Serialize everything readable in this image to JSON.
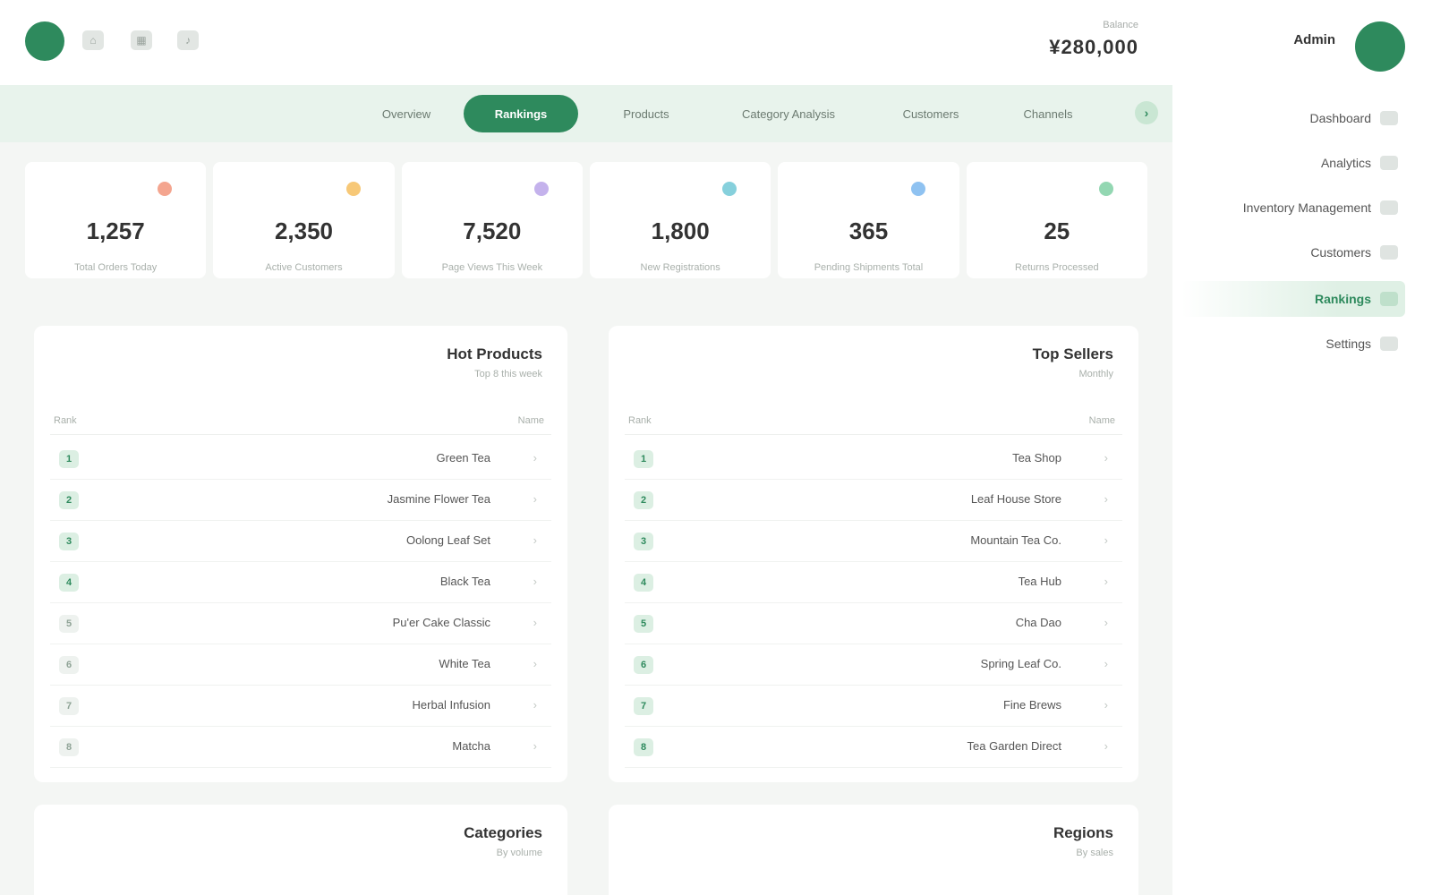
{
  "header": {
    "icons": [
      "home-icon",
      "grid-icon",
      "bell-icon"
    ],
    "subtitle": "Balance",
    "amount": "¥280,000"
  },
  "tabs": [
    {
      "label": "Overview"
    },
    {
      "label": "Rankings"
    },
    {
      "label": "Products"
    },
    {
      "label": "Category Analysis"
    },
    {
      "label": "Customers"
    },
    {
      "label": "Channels"
    }
  ],
  "stats": [
    {
      "value": "1,257",
      "label": "Total Orders Today",
      "color": "#f4a58f"
    },
    {
      "value": "2,350",
      "label": "Active Customers",
      "color": "#f7c877"
    },
    {
      "value": "7,520",
      "label": "Page Views This Week",
      "color": "#c4b2ec"
    },
    {
      "value": "1,800",
      "label": "New Registrations",
      "color": "#86d0dc"
    },
    {
      "value": "365",
      "label": "Pending Shipments Total",
      "color": "#8fc2f1"
    },
    {
      "value": "25",
      "label": "Returns Processed",
      "color": "#93d7b2"
    }
  ],
  "panels": [
    {
      "title": "Hot Products",
      "subtitle": "Top 8 this week",
      "col_rank": "Rank",
      "col_right": "Name",
      "rows": [
        {
          "rank": "1",
          "name": "Green Tea"
        },
        {
          "rank": "2",
          "name": "Jasmine Flower Tea"
        },
        {
          "rank": "3",
          "name": "Oolong Leaf Set"
        },
        {
          "rank": "4",
          "name": "Black Tea"
        },
        {
          "rank": "5",
          "name": "Pu'er Cake Classic"
        },
        {
          "rank": "6",
          "name": "White Tea"
        },
        {
          "rank": "7",
          "name": "Herbal Infusion"
        },
        {
          "rank": "8",
          "name": "Matcha"
        }
      ]
    },
    {
      "title": "Top Sellers",
      "subtitle": "Monthly",
      "col_rank": "Rank",
      "col_right": "Name",
      "rows": [
        {
          "rank": "1",
          "name": "Tea Shop"
        },
        {
          "rank": "2",
          "name": "Leaf House Store"
        },
        {
          "rank": "3",
          "name": "Mountain Tea Co."
        },
        {
          "rank": "4",
          "name": "Tea Hub"
        },
        {
          "rank": "5",
          "name": "Cha Dao"
        },
        {
          "rank": "6",
          "name": "Spring Leaf Co."
        },
        {
          "rank": "7",
          "name": "Fine Brews"
        },
        {
          "rank": "8",
          "name": "Tea Garden Direct"
        }
      ]
    },
    {
      "title": "Categories",
      "subtitle": "By volume"
    },
    {
      "title": "Regions",
      "subtitle": "By sales"
    }
  ],
  "sidebar": {
    "user_name": "Admin",
    "items": [
      {
        "label": "Dashboard",
        "icon": "dashboard-icon"
      },
      {
        "label": "Analytics",
        "icon": "chart-icon"
      },
      {
        "label": "Inventory Management",
        "icon": "box-icon"
      },
      {
        "label": "Customers",
        "icon": "users-icon"
      },
      {
        "label": "Rankings",
        "icon": "trophy-icon"
      },
      {
        "label": "Settings",
        "icon": "gear-icon"
      }
    ]
  }
}
